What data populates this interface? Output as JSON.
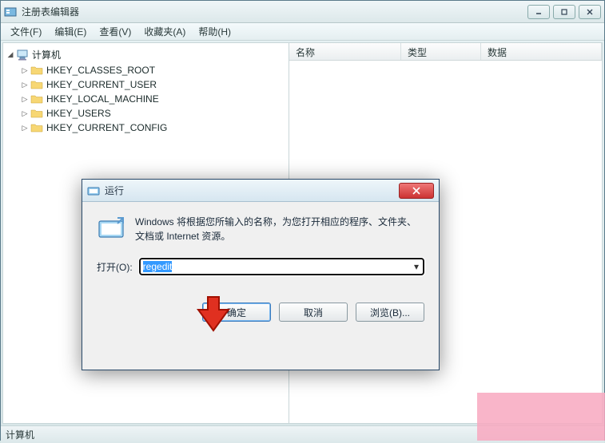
{
  "main": {
    "title": "注册表编辑器",
    "menus": [
      "文件(F)",
      "编辑(E)",
      "查看(V)",
      "收藏夹(A)",
      "帮助(H)"
    ],
    "tree": {
      "root": "计算机",
      "items": [
        "HKEY_CLASSES_ROOT",
        "HKEY_CURRENT_USER",
        "HKEY_LOCAL_MACHINE",
        "HKEY_USERS",
        "HKEY_CURRENT_CONFIG"
      ]
    },
    "columns": [
      "名称",
      "类型",
      "数据"
    ],
    "status": "计算机"
  },
  "run": {
    "title": "运行",
    "description": "Windows 将根据您所输入的名称，为您打开相应的程序、文件夹、文档或 Internet 资源。",
    "open_label": "打开(O):",
    "value": "regedit",
    "buttons": {
      "ok": "确定",
      "cancel": "取消",
      "browse": "浏览(B)..."
    }
  }
}
